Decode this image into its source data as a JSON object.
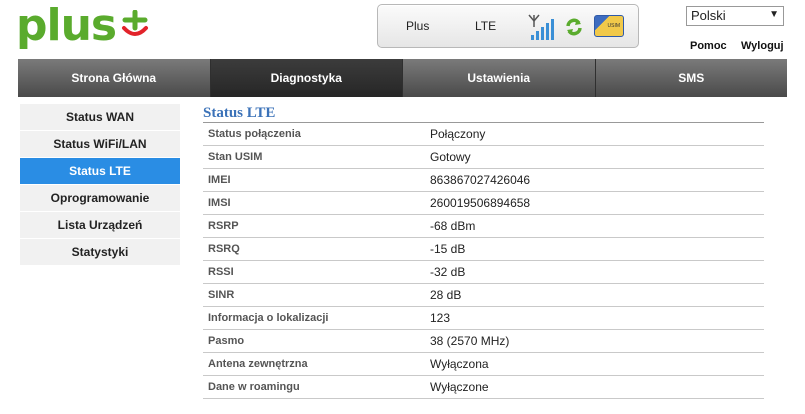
{
  "header": {
    "logo_text": "plus",
    "status": {
      "operator": "Plus",
      "network": "LTE",
      "sim_label": "USIM"
    },
    "language": "Polski",
    "help": "Pomoc",
    "logout": "Wyloguj"
  },
  "nav": {
    "tabs": [
      {
        "label": "Strona Główna"
      },
      {
        "label": "Diagnostyka"
      },
      {
        "label": "Ustawienia"
      },
      {
        "label": "SMS"
      }
    ],
    "active_index": 1
  },
  "sidebar": {
    "items": [
      {
        "label": "Status WAN"
      },
      {
        "label": "Status WiFi/LAN"
      },
      {
        "label": "Status LTE"
      },
      {
        "label": "Oprogramowanie"
      },
      {
        "label": "Lista Urządzeń"
      },
      {
        "label": "Statystyki"
      }
    ],
    "active_index": 2
  },
  "main": {
    "title": "Status LTE",
    "rows": [
      {
        "label": "Status połączenia",
        "value": "Połączony"
      },
      {
        "label": "Stan USIM",
        "value": "Gotowy"
      },
      {
        "label": "IMEI",
        "value": "863867027426046"
      },
      {
        "label": "IMSI",
        "value": "260019506894658"
      },
      {
        "label": "RSRP",
        "value": "-68 dBm"
      },
      {
        "label": "RSRQ",
        "value": "-15 dB"
      },
      {
        "label": "RSSI",
        "value": "-32 dB"
      },
      {
        "label": "SINR",
        "value": "28 dB"
      },
      {
        "label": "Informacja o lokalizacji",
        "value": "123"
      },
      {
        "label": "Pasmo",
        "value": "38 (2570 MHz)"
      },
      {
        "label": "Antena zewnętrzna",
        "value": "Wyłączona"
      },
      {
        "label": "Dane w roamingu",
        "value": "Wyłączone"
      }
    ]
  },
  "colors": {
    "brand_green": "#5aab2d",
    "accent_blue": "#2a8de4",
    "title_blue": "#3b72b8"
  }
}
